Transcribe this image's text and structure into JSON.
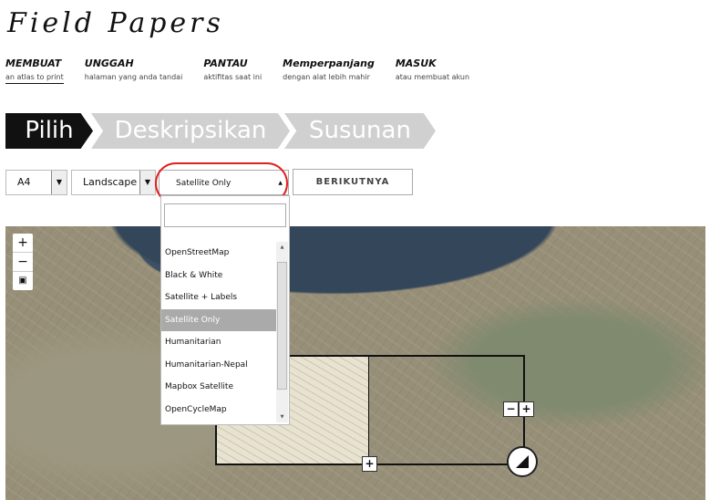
{
  "logo": {
    "text": "Field Papers"
  },
  "nav": [
    {
      "title": "MEMBUAT",
      "sub": "an atlas to print"
    },
    {
      "title": "UNGGAH",
      "sub": "halaman yang anda tandai"
    },
    {
      "title": "PANTAU",
      "sub": "aktifitas saat ini"
    },
    {
      "title": "Memperpanjang",
      "sub": "dengan alat lebih mahir"
    },
    {
      "title": "MASUK",
      "sub": "atau membuat akun"
    }
  ],
  "steps": [
    "Pilih",
    "Deskripsikan",
    "Susunan"
  ],
  "controls": {
    "paper_size": "A4",
    "orientation": "Landscape",
    "layer": "Satellite Only",
    "next_label": "BERIKUTNYA"
  },
  "dropdown": {
    "search_value": "",
    "options": [
      "OpenStreetMap",
      "Black & White",
      "Satellite + Labels",
      "Satellite Only",
      "Humanitarian",
      "Humanitarian-Nepal",
      "Mapbox Satellite",
      "OpenCycleMap"
    ],
    "selected": "Satellite Only"
  },
  "map": {
    "zoom_in": "+",
    "zoom_out": "−",
    "add_page_right_minus": "−",
    "add_page_right_plus": "+",
    "add_page_bottom": "+"
  }
}
